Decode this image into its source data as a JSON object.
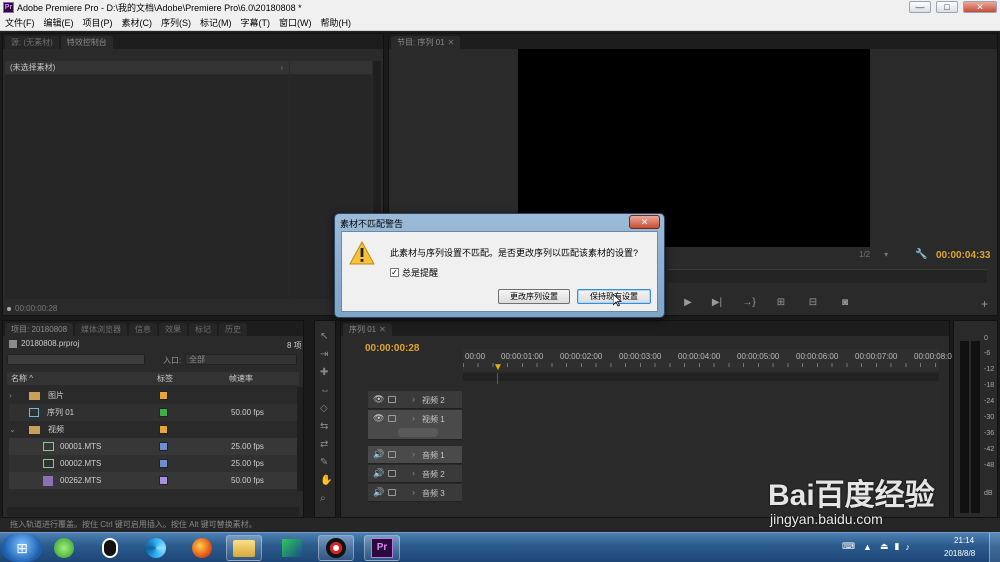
{
  "window": {
    "title": "Adobe Premiere Pro - D:\\我的文档\\Adobe\\Premiere Pro\\6.0\\20180808 *",
    "app_badge": "Pr",
    "minimize": "—",
    "maximize": "□",
    "close": "✕"
  },
  "menu": [
    "文件(F)",
    "编辑(E)",
    "项目(P)",
    "素材(C)",
    "序列(S)",
    "标记(M)",
    "字幕(T)",
    "窗口(W)",
    "帮助(H)"
  ],
  "source_panel": {
    "tabs": [
      "源: (无素材)",
      "特效控制台"
    ],
    "header": "(未选择素材)",
    "timecode": "00:00:00:28"
  },
  "program_panel": {
    "tab": "节目: 序列 01",
    "zoom": "1/2",
    "timecode": "00:00:04:33"
  },
  "project_panel": {
    "tabs": [
      "项目: 20180808",
      "媒体浏览器",
      "信息",
      "效果",
      "标记",
      "历史"
    ],
    "project_file": "20180808.prproj",
    "item_count": "8 项",
    "in_label": "入口:",
    "in_value": "全部",
    "columns": [
      "名称",
      "标签",
      "帧速率"
    ],
    "items": [
      {
        "name": "图片",
        "color": "#e8a33b",
        "fps": ""
      },
      {
        "name": "序列 01",
        "color": "#3fae4a",
        "fps": "50.00 fps"
      },
      {
        "name": "视频",
        "color": "#e8a33b",
        "fps": ""
      },
      {
        "name": "00001.MTS",
        "color": "#6d8fd0",
        "fps": "25.00 fps"
      },
      {
        "name": "00002.MTS",
        "color": "#6d8fd0",
        "fps": "25.00 fps"
      },
      {
        "name": "00262.MTS",
        "color": "#a98fe0",
        "fps": "50.00 fps"
      }
    ]
  },
  "timeline": {
    "tab": "序列 01",
    "timecode": "00:00:00:28",
    "ruler": [
      "00:00",
      "00:00:01:00",
      "00:00:02:00",
      "00:00:03:00",
      "00:00:04:00",
      "00:00:05:00",
      "00:00:06:00",
      "00:00:07:00",
      "00:00:08:0"
    ],
    "video_tracks": [
      "视频 2",
      "视频 1"
    ],
    "audio_tracks": [
      "音频 1",
      "音频 2",
      "音频 3"
    ]
  },
  "meter": {
    "scale": [
      "0",
      "-6",
      "-12",
      "-18",
      "-24",
      "-30",
      "-36",
      "-42",
      "-48",
      "dB"
    ]
  },
  "status_bar": "拖入轨道进行覆盖。按住 Ctrl 键可启用插入。按住 Alt 键可替换素材。",
  "dialog": {
    "title": "素材不匹配警告",
    "message": "此素材与序列设置不匹配。是否更改序列以匹配该素材的设置?",
    "checkbox_label": "总是提醒",
    "checkbox_checked": true,
    "btn_change": "更改序列设置",
    "btn_keep": "保持现有设置"
  },
  "taskbar": {
    "time": "21:14",
    "date": "2018/8/8",
    "pr_label": "Pr"
  },
  "watermark": {
    "brand": "Bai百度经验",
    "url": "jingyan.baidu.com"
  }
}
